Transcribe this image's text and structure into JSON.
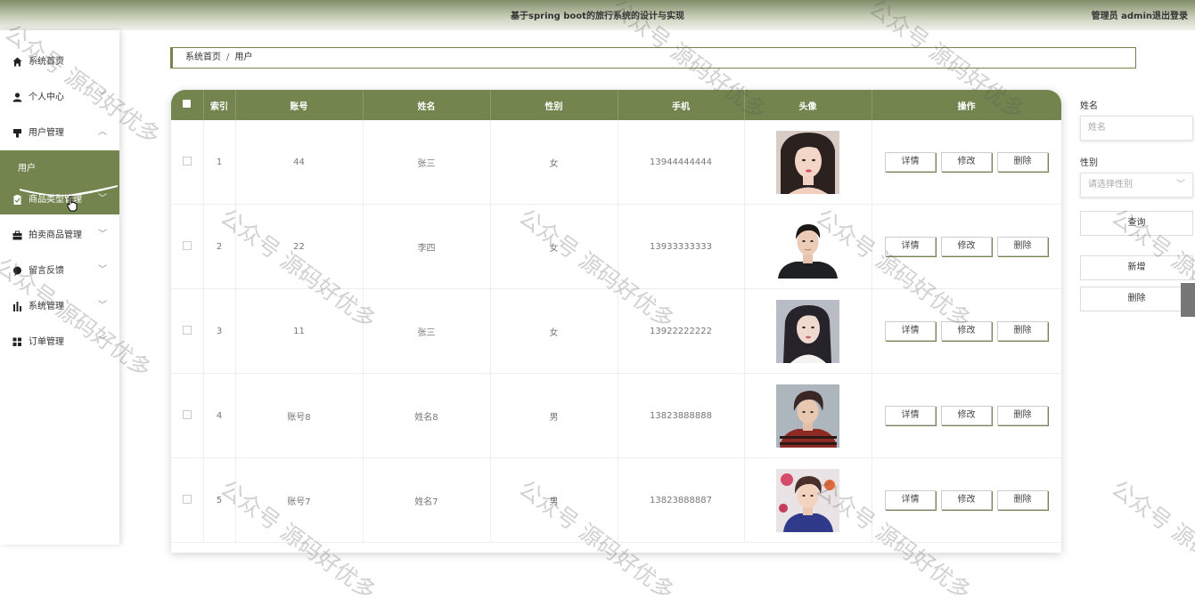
{
  "header": {
    "title": "基于spring boot的旅行系统的设计与实现",
    "user": "管理员 admin",
    "logout": "退出登录"
  },
  "sidebar": {
    "items": [
      {
        "label": "系统首页",
        "icon": "home-icon",
        "arrow": ""
      },
      {
        "label": "个人中心",
        "icon": "person-icon",
        "arrow": "﹀"
      },
      {
        "label": "用户管理",
        "icon": "user-manage-icon",
        "arrow": "︿"
      },
      {
        "label": "商品类型管理",
        "icon": "clipboard-icon",
        "arrow": "﹀"
      },
      {
        "label": "拍卖商品管理",
        "icon": "briefcase-icon",
        "arrow": "﹀"
      },
      {
        "label": "留言反馈",
        "icon": "feedback-icon",
        "arrow": "﹀"
      },
      {
        "label": "系统管理",
        "icon": "bar-chart-icon",
        "arrow": "﹀"
      },
      {
        "label": "订单管理",
        "icon": "grid-icon",
        "arrow": "﹀"
      }
    ],
    "active_sub": "用户"
  },
  "breadcrumb": {
    "home": "系统首页",
    "sep": "/",
    "current": "用户"
  },
  "table": {
    "headers": [
      "索引",
      "账号",
      "姓名",
      "性别",
      "手机",
      "头像",
      "操作"
    ],
    "rows": [
      {
        "index": "1",
        "account": "44",
        "name": "张三",
        "gender": "女",
        "phone": "13944444444",
        "avatar": "avatar-female-1"
      },
      {
        "index": "2",
        "account": "22",
        "name": "李四",
        "gender": "女",
        "phone": "13933333333",
        "avatar": "avatar-male-1"
      },
      {
        "index": "3",
        "account": "11",
        "name": "张三",
        "gender": "女",
        "phone": "13922222222",
        "avatar": "avatar-female-2"
      },
      {
        "index": "4",
        "account": "账号8",
        "name": "姓名8",
        "gender": "男",
        "phone": "13823888888",
        "avatar": "avatar-male-2"
      },
      {
        "index": "5",
        "account": "账号7",
        "name": "姓名7",
        "gender": "男",
        "phone": "13823888887",
        "avatar": "avatar-male-3"
      }
    ],
    "actions": {
      "detail": "详情",
      "edit": "修改",
      "delete": "删除"
    }
  },
  "search": {
    "name_label": "姓名",
    "name_placeholder": "姓名",
    "gender_label": "性别",
    "gender_placeholder": "请选择性别",
    "query_button": "查询",
    "add_button": "新增",
    "delete_button": "删除"
  },
  "watermark": "公众号 源码好优多",
  "colors": {
    "accent": "#73844e",
    "header_top": "#7f8c68"
  }
}
